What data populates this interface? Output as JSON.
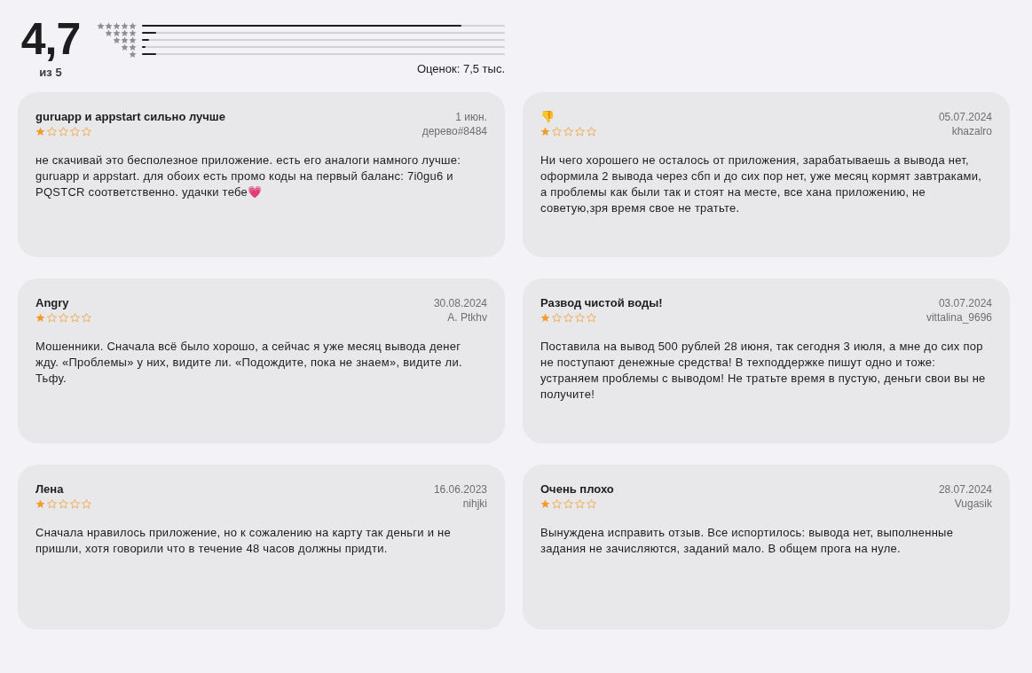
{
  "summary": {
    "score": "4,7",
    "out_of": "из 5",
    "count": "Оценок: 7,5 тыс.",
    "histogram": [
      {
        "level": 0.88
      },
      {
        "level": 0.04
      },
      {
        "level": 0.02
      },
      {
        "level": 0.01
      },
      {
        "level": 0.04
      }
    ]
  },
  "reviews": [
    {
      "title": "guruapp и appstart сильно лучше",
      "date": "1 июн.",
      "author": "дерево#8484",
      "stars": 1,
      "text": "не скачивай это бесполезное приложение. есть его аналоги намного лучше: guruapp и appstart. для обоих есть промо коды на первый баланс: 7i0gu6 и PQSTCR соответственно. удачки тебе💗"
    },
    {
      "title": "👎",
      "date": "05.07.2024",
      "author": "khazalro",
      "stars": 1,
      "text": "Ни чего хорошего не осталось от приложения, зарабатываешь а вывода нет, оформила 2 вывода через сбп и до сих пор нет, уже месяц кормят завтраками, а проблемы как были так и стоят на месте, все хана приложению, не советую,зря время свое не тратьте."
    },
    {
      "title": "Angry",
      "date": "30.08.2024",
      "author": "A. Ptkhv",
      "stars": 1,
      "text": "Мошенники. Сначала всё было хорошо, а сейчас я уже месяц вывода денег жду. «Проблемы» у них, видите ли. «Подождите, пока не знаем», видите ли. Тьфу."
    },
    {
      "title": "Развод чистой воды!",
      "date": "03.07.2024",
      "author": "vittalina_9696",
      "stars": 1,
      "text": "Поставила на вывод 500 рублей 28 июня, так сегодня 3 июля, а мне до сих пор не поступают денежные средства! В техподдержке пишут одно и тоже: устраняем проблемы с выводом! Не тратьте время в пустую, деньги свои вы не получите!"
    },
    {
      "title": "Лена",
      "date": "16.06.2023",
      "author": "nihjki",
      "stars": 1,
      "text": "Сначала нравилось приложение, но к сожалению на карту так деньги и не пришли, хотя говорили что в течение 48 часов должны придти."
    },
    {
      "title": "Очень плохо",
      "date": "28.07.2024",
      "author": "Vugasik",
      "stars": 1,
      "text": "Вынуждена исправить отзыв. Все испортилось: вывода нет, выполненные задания не зачисляются, заданий мало. В общем прога на нуле."
    }
  ]
}
